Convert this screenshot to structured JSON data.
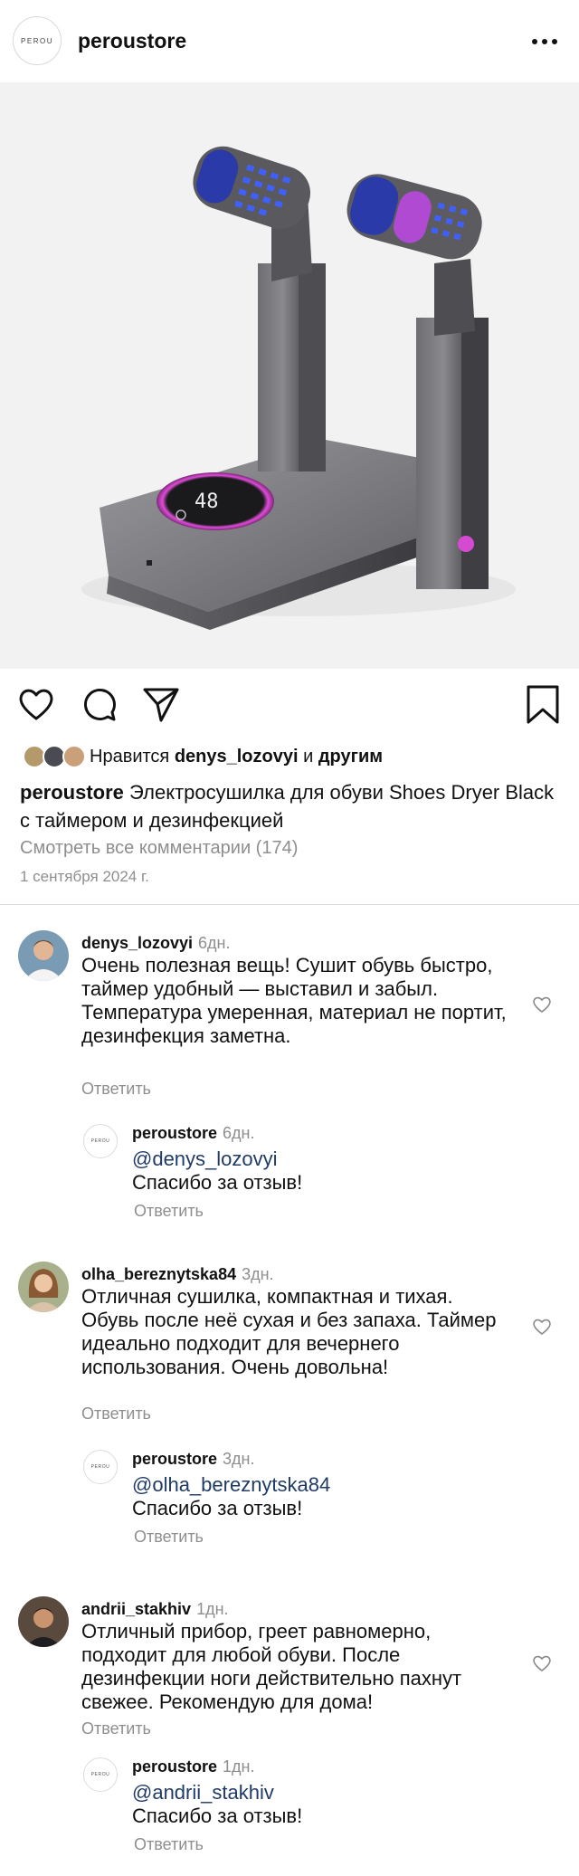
{
  "header": {
    "logo_text": "PEROU",
    "username": "peroustore",
    "more_icon": "more-horizontal-icon"
  },
  "post": {
    "liked_by_prefix": "Нравится",
    "liked_by_user": "denys_lozovyi",
    "liked_by_and": "и",
    "liked_by_others": "другим",
    "caption_user": "peroustore",
    "caption_text": "Электросушилка для обуви Shoes Dryer Black с таймером и дезинфекцией",
    "view_all_comments": "Смотреть все комментарии (174)",
    "date": "1 сентября 2024 г.",
    "display_digits": "48"
  },
  "comments": [
    {
      "user": "denys_lozovyi",
      "time": "6дн.",
      "text": "Очень полезная вещь! Сушит обувь быстро, таймер удобный — выставил и забыл. Температура умеренная, материал не портит, дезинфекция заметна.",
      "reply_label": "Ответить",
      "response": {
        "user": "peroustore",
        "time": "6дн.",
        "mention": "@denys_lozovyi",
        "text": "Спасибо за отзыв!",
        "reply_label": "Ответить"
      }
    },
    {
      "user": "olha_bereznytska84",
      "time": "3дн.",
      "text": "Отличная сушилка, компактная и тихая. Обувь после неё сухая и без запаха. Таймер идеально подходит для вечернего использования. Очень довольна!",
      "reply_label": "Ответить",
      "response": {
        "user": "peroustore",
        "time": "3дн.",
        "mention": "@olha_bereznytska84",
        "text": "Спасибо за отзыв!",
        "reply_label": "Ответить"
      }
    },
    {
      "user": "andrii_stakhiv",
      "time": "1дн.",
      "text": "Отличный прибор, греет равномерно, подходит для любой обуви. После дезинфекции ноги действительно пахнут свежее. Рекомендую для дома!",
      "reply_label": "Ответить",
      "response": {
        "user": "peroustore",
        "time": "1дн.",
        "mention": "@andrii_stakhiv",
        "text": "Спасибо за отзыв!",
        "reply_label": "Ответить"
      }
    }
  ],
  "icons": {
    "like": "heart-icon",
    "comment": "comment-icon",
    "share": "send-icon",
    "save": "bookmark-icon"
  },
  "colors": {
    "text": "#111111",
    "muted": "#8e8e8e",
    "mention": "#1f3b66",
    "divider": "#dbdbdb"
  }
}
